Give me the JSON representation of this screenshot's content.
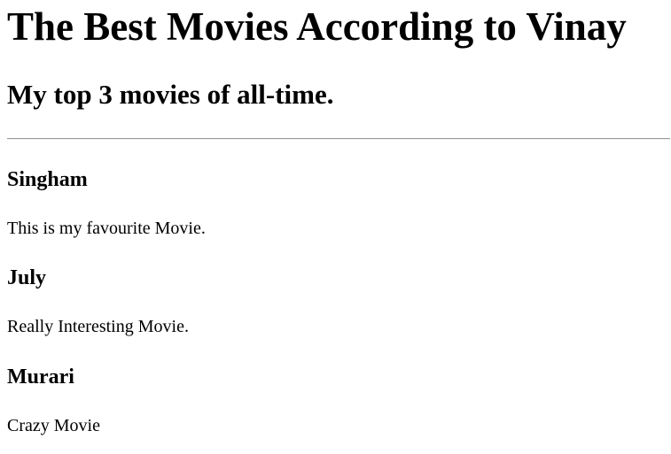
{
  "header": {
    "title": "The Best Movies According to Vinay",
    "subtitle": "My top 3 movies of all-time."
  },
  "movies": [
    {
      "title": "Singham",
      "description": "This is my favourite Movie."
    },
    {
      "title": "July",
      "description": "Really Interesting Movie."
    },
    {
      "title": "Murari",
      "description": "Crazy Movie"
    }
  ]
}
